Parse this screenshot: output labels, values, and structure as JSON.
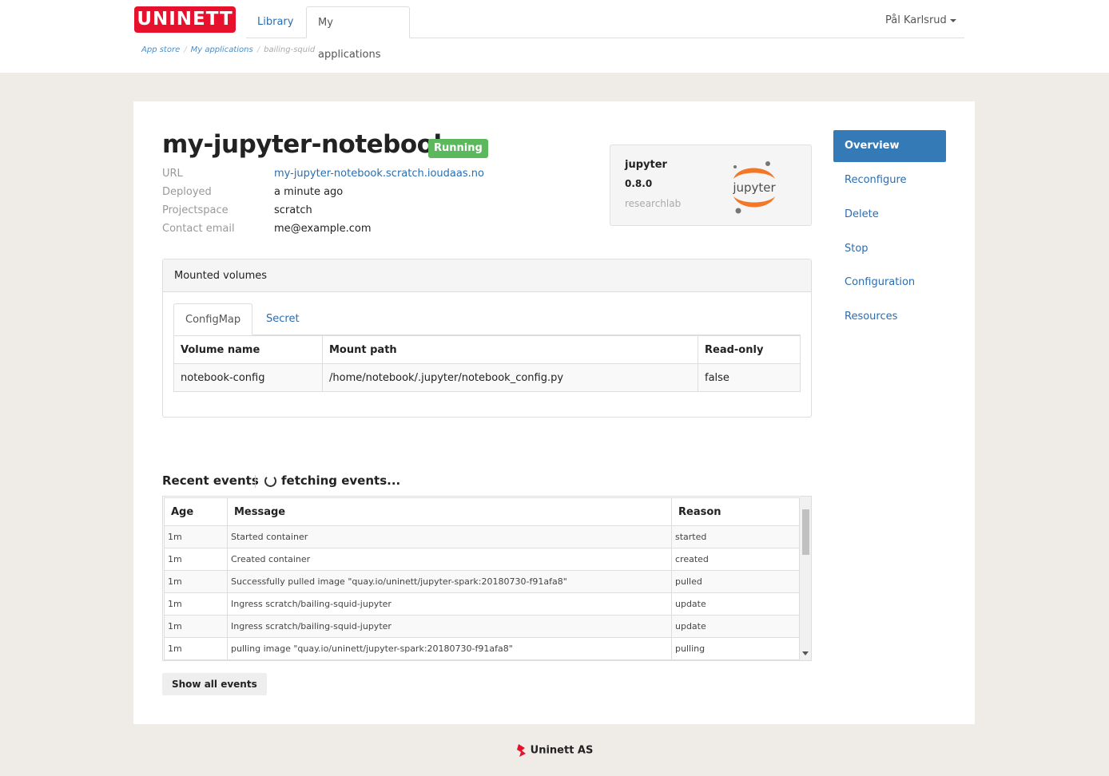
{
  "header": {
    "logo_text": "UNINETT",
    "nav": [
      {
        "label": "Library"
      },
      {
        "label": "My applications"
      }
    ],
    "user_name": "Pål Karlsrud"
  },
  "breadcrumb": {
    "items": [
      "App store",
      "My applications",
      "bailing-squid"
    ]
  },
  "app": {
    "title": "my-jupyter-notebook",
    "status": "Running",
    "info": [
      {
        "label": "URL",
        "value": "my-jupyter-notebook.scratch.ioudaas.no"
      },
      {
        "label": "Deployed",
        "value": "a minute ago"
      },
      {
        "label": "Projectspace",
        "value": "scratch"
      },
      {
        "label": "Contact email",
        "value": "me@example.com"
      }
    ]
  },
  "app_card": {
    "name": "jupyter",
    "version": "0.8.0",
    "vendor": "researchlab",
    "logo_text": "jupyter",
    "logo_icon": "jupyter-logo-icon"
  },
  "sidebar": {
    "items": [
      {
        "label": "Overview"
      },
      {
        "label": "Reconfigure"
      },
      {
        "label": "Delete"
      },
      {
        "label": "Stop"
      },
      {
        "label": "Configuration"
      },
      {
        "label": "Resources"
      }
    ]
  },
  "volumes": {
    "heading": "Mounted volumes",
    "tabs": [
      "ConfigMap",
      "Secret"
    ],
    "columns": [
      "Volume name",
      "Mount path",
      "Read-only"
    ],
    "rows": [
      {
        "name": "notebook-config",
        "path": "/home/notebook/.jupyter/notebook_config.py",
        "readonly": "false"
      }
    ]
  },
  "events": {
    "title": "Recent events",
    "status": "fetching events...",
    "columns": [
      "Age",
      "Message",
      "Reason"
    ],
    "rows": [
      {
        "age": "1m",
        "message": "Started container",
        "reason": "started"
      },
      {
        "age": "1m",
        "message": "Created container",
        "reason": "created"
      },
      {
        "age": "1m",
        "message": "Successfully pulled image \"quay.io/uninett/jupyter-spark:20180730-f91afa8\"",
        "reason": "pulled"
      },
      {
        "age": "1m",
        "message": "Ingress scratch/bailing-squid-jupyter",
        "reason": "update"
      },
      {
        "age": "1m",
        "message": "Ingress scratch/bailing-squid-jupyter",
        "reason": "update"
      },
      {
        "age": "1m",
        "message": "pulling image \"quay.io/uninett/jupyter-spark:20180730-f91afa8\"",
        "reason": "pulling"
      }
    ],
    "show_all_label": "Show all events"
  },
  "footer": {
    "text": "Uninett AS"
  },
  "colors": {
    "brand_red": "#e8112d",
    "link_blue": "#2a6db0",
    "active_blue": "#337ab7",
    "status_green": "#5cb85c",
    "page_bg": "#efebe7"
  }
}
